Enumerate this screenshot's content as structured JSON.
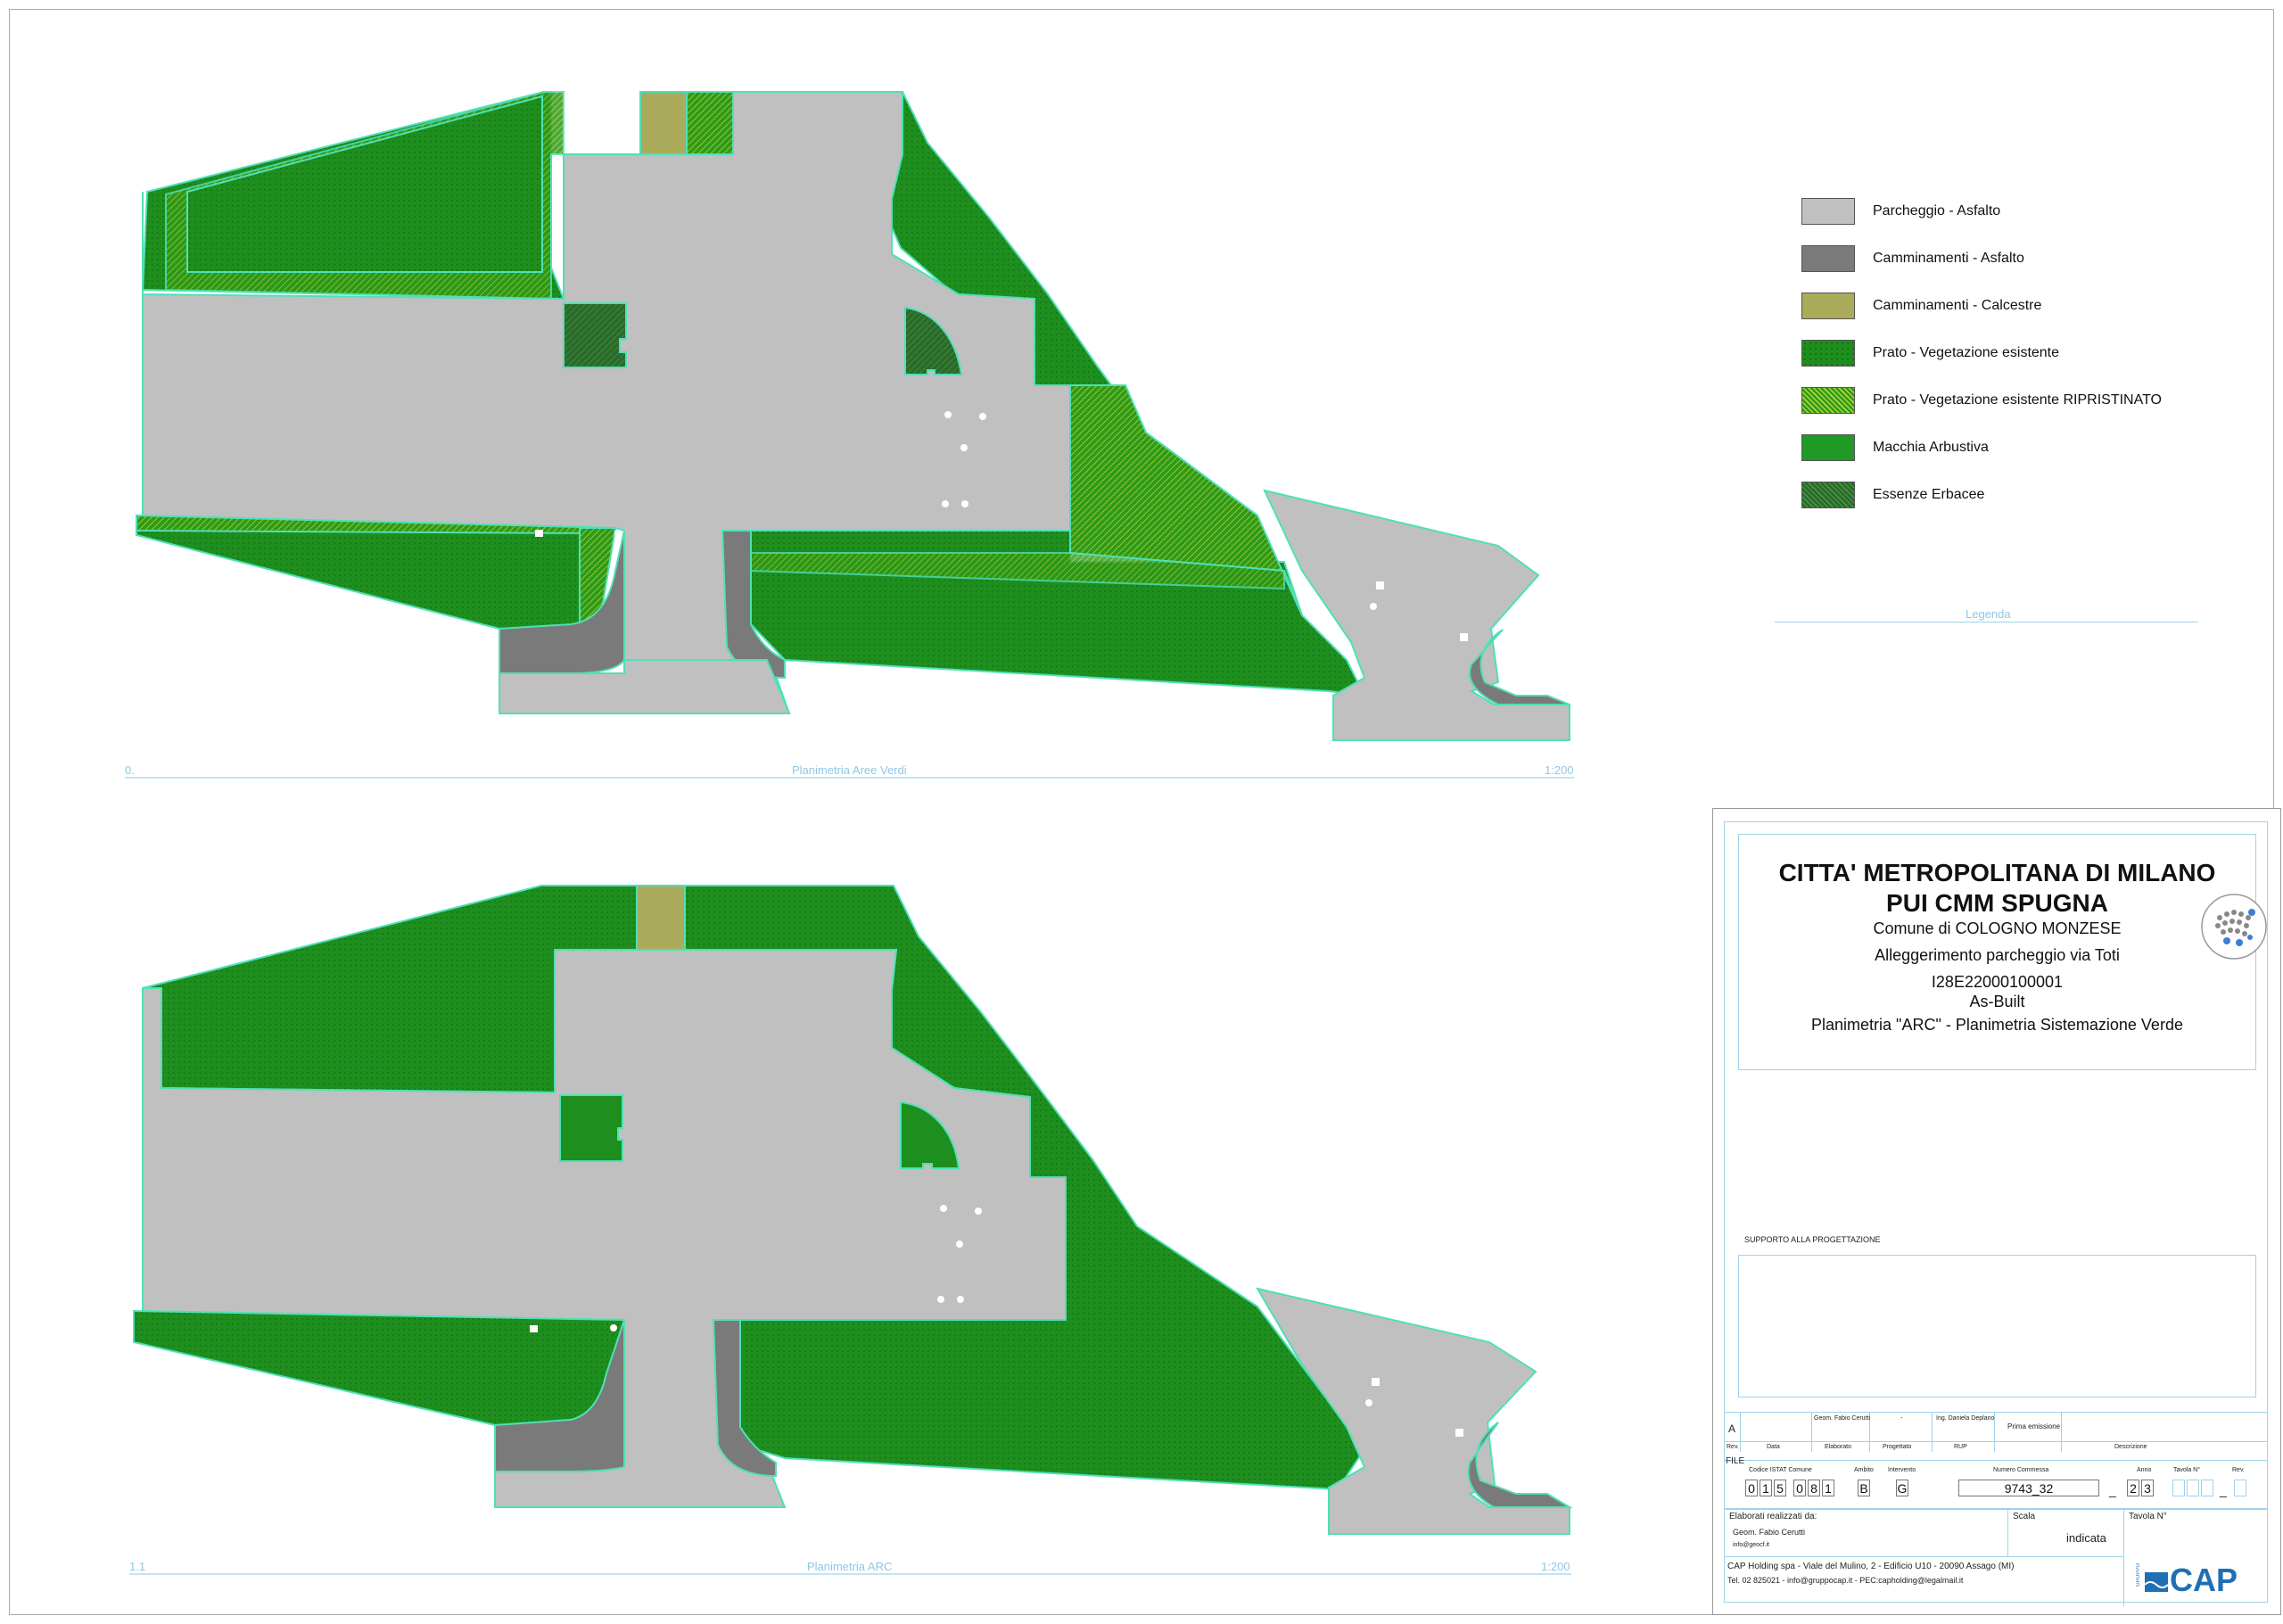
{
  "colors": {
    "parcheggio": "#c0c0c0",
    "camminamenti_asfalto": "#7a7a7a",
    "camminamenti_calcestre": "#abab5c",
    "prato": "#1e8f1e",
    "prato_ripristinato": "#6bbf1e",
    "macchia": "#1f9a26",
    "essenze": "#2d6e2d",
    "outline": "#4fe0b8",
    "caption": "#8ec7e6"
  },
  "legend": {
    "items": [
      {
        "label": "Parcheggio - Asfalto",
        "color": "#c0c0c0",
        "pattern": "solid"
      },
      {
        "label": "Camminamenti - Asfalto",
        "color": "#7a7a7a",
        "pattern": "solid"
      },
      {
        "label": "Camminamenti - Calcestre",
        "color": "#abab5c",
        "pattern": "solid"
      },
      {
        "label": "Prato - Vegetazione esistente",
        "color": "#1e8f1e",
        "pattern": "dots"
      },
      {
        "label": "Prato - Vegetazione esistente RIPRISTINATO",
        "color": "#6bbf1e",
        "pattern": "hatch"
      },
      {
        "label": "Macchia Arbustiva",
        "color": "#1f9a26",
        "pattern": "solid"
      },
      {
        "label": "Essenze Erbacee",
        "color": "#2d6e2d",
        "pattern": "hatch"
      }
    ],
    "title": "Legenda"
  },
  "plan_top": {
    "number": "0.",
    "title": "Planimetria Aree Verdi",
    "scale": "1:200"
  },
  "plan_bottom": {
    "number": "1.1",
    "title": "Planimetria ARC",
    "scale": "1:200"
  },
  "title_block": {
    "line1": "CITTA' METROPOLITANA DI MILANO",
    "line2": "PUI CMM SPUGNA",
    "comune": "Comune di COLOGNO MONZESE",
    "project": "Alleggerimento parcheggio via Toti",
    "code": "I28E22000100001",
    "status": "As-Built",
    "sheet": "Planimetria \"ARC\" - Planimetria Sistemazione Verde",
    "support_label": "SUPPORTO ALLA PROGETTAZIONE",
    "revision": {
      "rev": "A",
      "elaborato": "Geom. Fabio Cerutti",
      "progettato": "-",
      "rup": "Ing. Daniela Deplano",
      "descrizione": "Prima emissione"
    },
    "rev_headers": [
      "Rev.",
      "Data",
      "Elaborato",
      "Progettato",
      "RUP",
      "Descrizione"
    ],
    "file_label": "FILE",
    "codice_istat_label": "Codice ISTAT Comune",
    "codice_istat_a": [
      "0",
      "1",
      "5"
    ],
    "codice_istat_b": [
      "0",
      "8",
      "1"
    ],
    "ambito_label": "Ambito",
    "ambito": "B",
    "intervento_label": "Intervento",
    "intervento": "G",
    "commessa_label": "Numero Commessa",
    "commessa": "9743_32",
    "anno_label": "Anno",
    "anno": [
      "2",
      "3"
    ],
    "tavola_label": "Tavola N°",
    "rev_label": "Rev.",
    "sep": "_",
    "elaborati_label": "Elaborati realizzati da:",
    "author": "Geom. Fabio Cerutti",
    "author_email": "info@geocf.it",
    "scala_label": "Scala",
    "scala": "indicata",
    "tavola_n_label": "Tavola N°",
    "company": "CAP Holding spa - Viale del Mulino, 2 - Edificio U10 - 20090 Assago (MI)",
    "contacts": "Tel. 02 825021  -  info@gruppocap.it  -  PEC:capholding@legalmail.it",
    "logo_text": "CAP",
    "logo_small": "GRUPPO"
  }
}
